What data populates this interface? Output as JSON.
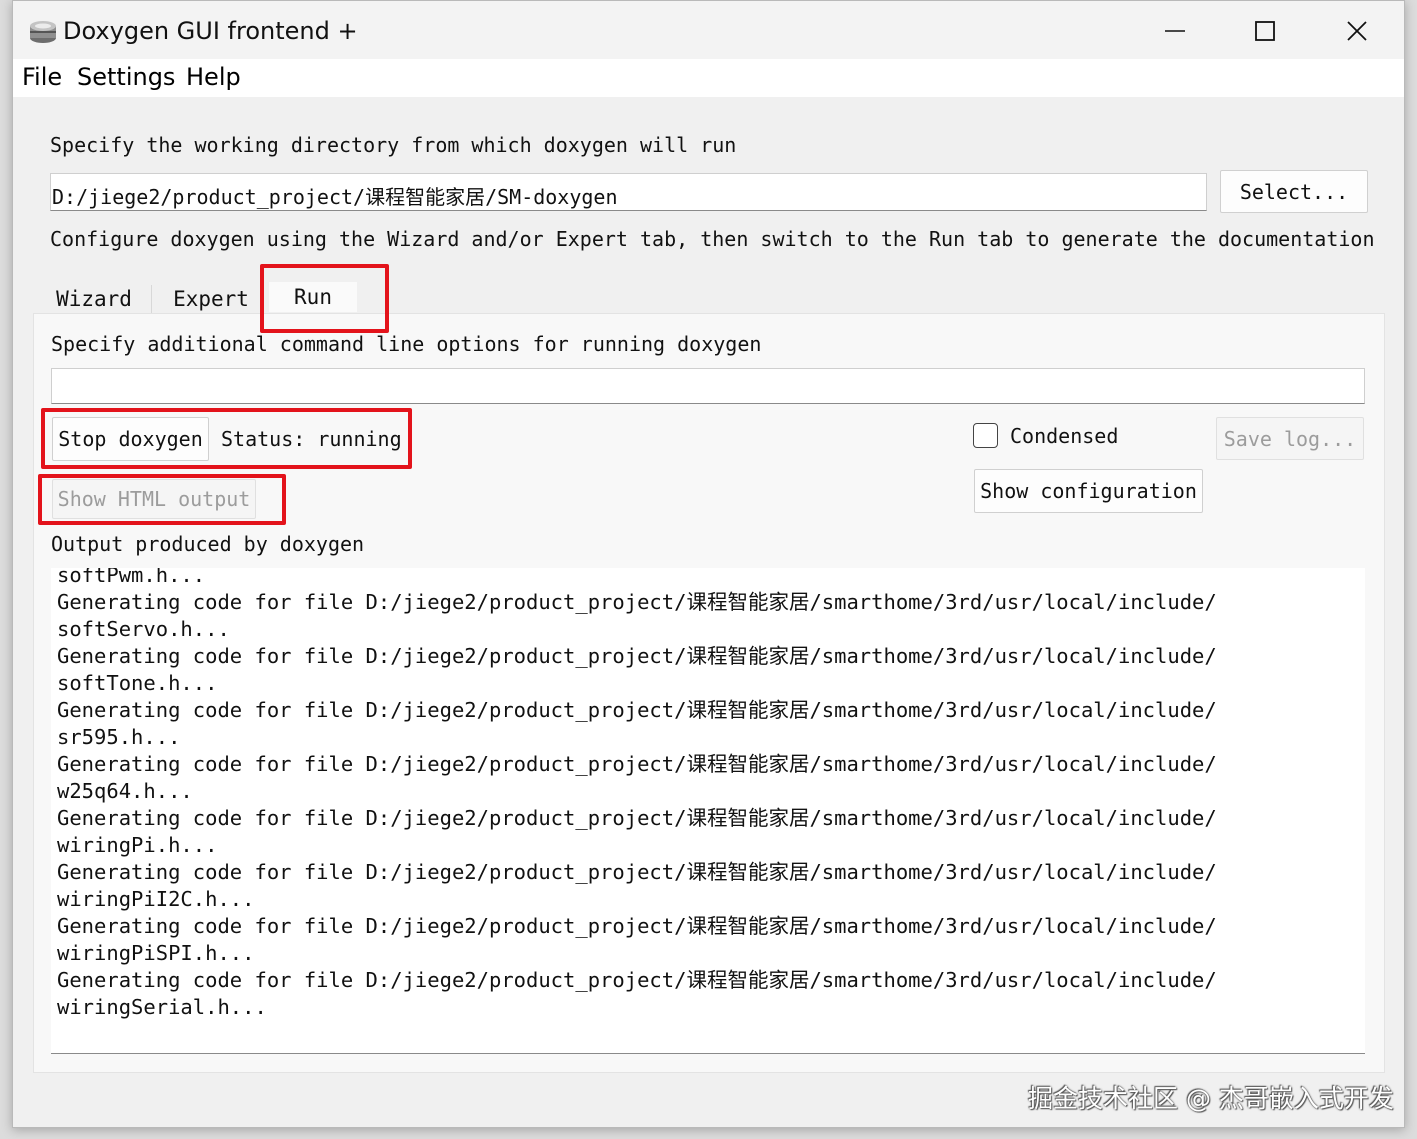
{
  "window": {
    "title": "Doxygen GUI frontend +"
  },
  "menu": {
    "file": "File",
    "settings": "Settings",
    "help": "Help"
  },
  "working_dir": {
    "prompt": "Specify the working directory from which doxygen will run",
    "value": "D:/jiege2/product_project/课程智能家居/SM-doxygen",
    "select_label": "Select...",
    "hint": "Configure doxygen using the Wizard and/or Expert tab, then switch to the Run tab to generate the documentation"
  },
  "tabs": [
    {
      "label": "Wizard",
      "selected": false
    },
    {
      "label": "Expert",
      "selected": false
    },
    {
      "label": "Run",
      "selected": true
    }
  ],
  "run": {
    "options_label": "Specify additional command line options for running doxygen",
    "options_value": "",
    "stop_label": "Stop doxygen",
    "status_text": "Status: running",
    "condensed_label": "Condensed",
    "condensed_checked": false,
    "save_log_label": "Save log...",
    "show_html_label": "Show HTML output",
    "show_config_label": "Show configuration",
    "output_label": "Output produced by doxygen",
    "output_lines": [
      "softPwm.h...",
      "Generating code for file D:/jiege2/product_project/课程智能家居/smarthome/3rd/usr/local/include/",
      "softServo.h...",
      "Generating code for file D:/jiege2/product_project/课程智能家居/smarthome/3rd/usr/local/include/",
      "softTone.h...",
      "Generating code for file D:/jiege2/product_project/课程智能家居/smarthome/3rd/usr/local/include/",
      "sr595.h...",
      "Generating code for file D:/jiege2/product_project/课程智能家居/smarthome/3rd/usr/local/include/",
      "w25q64.h...",
      "Generating code for file D:/jiege2/product_project/课程智能家居/smarthome/3rd/usr/local/include/",
      "wiringPi.h...",
      "Generating code for file D:/jiege2/product_project/课程智能家居/smarthome/3rd/usr/local/include/",
      "wiringPiI2C.h...",
      "Generating code for file D:/jiege2/product_project/课程智能家居/smarthome/3rd/usr/local/include/",
      "wiringPiSPI.h...",
      "Generating code for file D:/jiege2/product_project/课程智能家居/smarthome/3rd/usr/local/include/",
      "wiringSerial.h..."
    ]
  },
  "watermark": "掘金技术社区 @ 杰哥嵌入式开发",
  "colors": {
    "highlight": "#e3131b",
    "window_bg": "#f0f0f0",
    "panel_bg": "#f8f8f8"
  },
  "icons": [
    "doxygen-app-icon",
    "minimize-icon",
    "maximize-icon",
    "close-icon",
    "checkbox-icon"
  ]
}
